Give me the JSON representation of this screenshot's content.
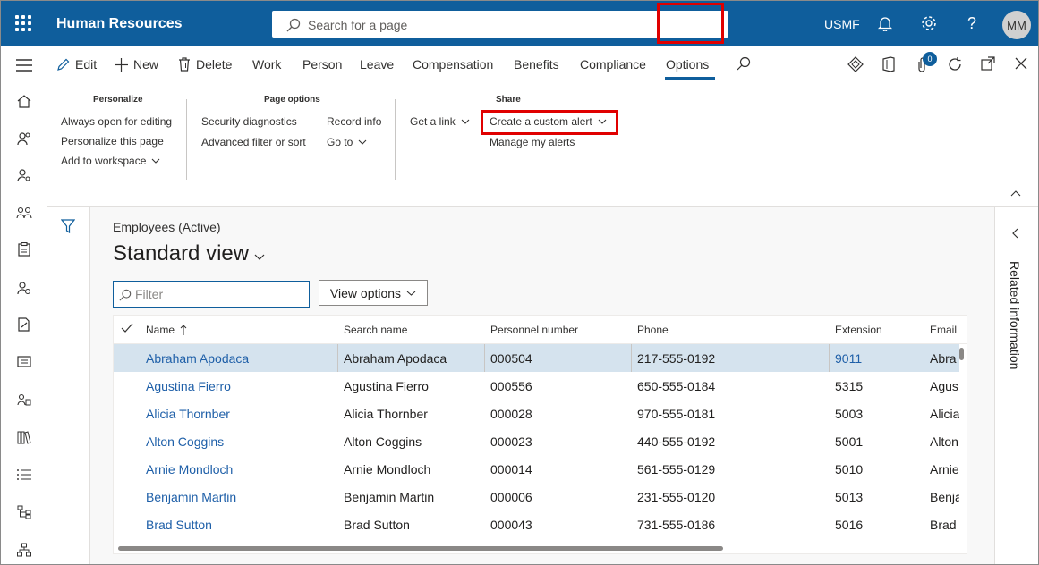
{
  "app": {
    "title": "Human Resources",
    "company": "USMF",
    "avatar": "MM",
    "search_placeholder": "Search for a page",
    "notifications_count": "0"
  },
  "actions": [
    {
      "label": "Edit",
      "icon": "pencil-icon"
    },
    {
      "label": "New",
      "icon": "plus-icon"
    },
    {
      "label": "Delete",
      "icon": "trash-icon"
    }
  ],
  "tabs": [
    "Work",
    "Person",
    "Leave",
    "Compensation",
    "Benefits",
    "Compliance",
    "Options"
  ],
  "active_tab": "Options",
  "ribbon": {
    "personalize": {
      "header": "Personalize",
      "items": [
        "Always open for editing",
        "Personalize this page",
        "Add to workspace"
      ]
    },
    "page_options": {
      "header": "Page options",
      "col1": [
        "Security diagnostics",
        "Advanced filter or sort"
      ],
      "col2": [
        "Record info",
        "Go to"
      ]
    },
    "get_link": "Get a link",
    "share": {
      "header": "Share",
      "items": [
        "Create a custom alert",
        "Manage my alerts"
      ]
    }
  },
  "main": {
    "breadcrumb": "Employees (Active)",
    "view_title": "Standard view",
    "filter_placeholder": "Filter",
    "view_options": "View options",
    "columns": [
      "Name",
      "Search name",
      "Personnel number",
      "Phone",
      "Extension",
      "Email"
    ],
    "rows": [
      [
        "Abraham Apodaca",
        "Abraham Apodaca",
        "000504",
        "217-555-0192",
        "9011",
        "Abra"
      ],
      [
        "Agustina Fierro",
        "Agustina Fierro",
        "000556",
        "650-555-0184",
        "5315",
        "Agus"
      ],
      [
        "Alicia Thornber",
        "Alicia Thornber",
        "000028",
        "970-555-0181",
        "5003",
        "Alicia"
      ],
      [
        "Alton Coggins",
        "Alton Coggins",
        "000023",
        "440-555-0192",
        "5001",
        "Alton"
      ],
      [
        "Arnie Mondloch",
        "Arnie Mondloch",
        "000014",
        "561-555-0129",
        "5010",
        "Arnie"
      ],
      [
        "Benjamin Martin",
        "Benjamin Martin",
        "000006",
        "231-555-0120",
        "5013",
        "Benja"
      ],
      [
        "Brad Sutton",
        "Brad Sutton",
        "000043",
        "731-555-0186",
        "5016",
        "Brad"
      ]
    ]
  },
  "related": {
    "label": "Related information"
  },
  "colors": {
    "brand": "#0f5e9c",
    "highlight": "#e00000",
    "selected_row": "#d5e3ee",
    "link": "#1e5fa8"
  }
}
